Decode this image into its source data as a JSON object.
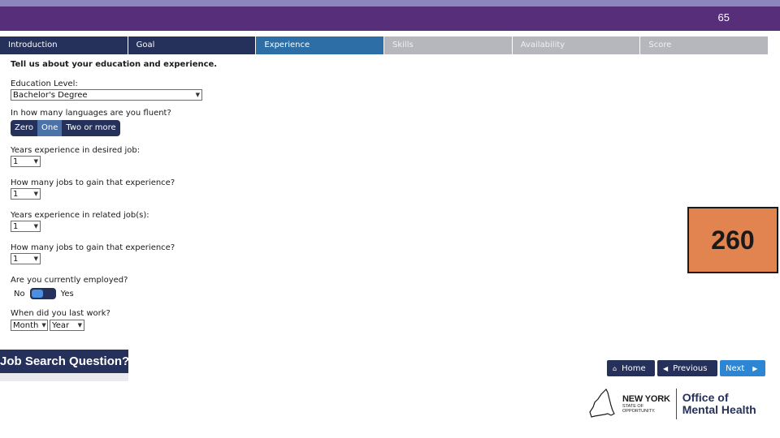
{
  "slide_number": "65",
  "tabs": [
    {
      "label": "Introduction",
      "state": "done"
    },
    {
      "label": "Goal",
      "state": "done"
    },
    {
      "label": "Experience",
      "state": "active"
    },
    {
      "label": "Skills",
      "state": "todo"
    },
    {
      "label": "Availability",
      "state": "todo"
    },
    {
      "label": "Score",
      "state": "todo"
    }
  ],
  "form": {
    "heading": "Tell us about your education and experience.",
    "education": {
      "label": "Education Level:",
      "value": "Bachelor's Degree"
    },
    "languages": {
      "label": "In how many languages are you fluent?",
      "options": [
        "Zero",
        "One",
        "Two or more"
      ],
      "selected": "One"
    },
    "years_desired": {
      "label": "Years experience in desired job:",
      "value": "1"
    },
    "jobs_desired": {
      "label": "How many jobs to gain that experience?",
      "value": "1"
    },
    "years_related": {
      "label": "Years experience in related job(s):",
      "value": "1"
    },
    "jobs_related": {
      "label": "How many jobs to gain that experience?",
      "value": "1"
    },
    "employed": {
      "label": "Are you currently employed?",
      "no_label": "No",
      "yes_label": "Yes",
      "value": "No"
    },
    "last_work": {
      "label": "When did you last work?",
      "month": "Month",
      "year": "Year"
    }
  },
  "badge": {
    "value": "260",
    "color": "#e2844f"
  },
  "job_search_title": "Job Search Question?",
  "nav": {
    "home": "Home",
    "previous": "Previous",
    "next": "Next"
  },
  "logo": {
    "state_line1": "NEW YORK",
    "state_line2": "STATE OF",
    "state_line3": "OPPORTUNITY.",
    "agency_line1": "Office of",
    "agency_line2": "Mental Health"
  },
  "colors": {
    "header_purple": "#572e7a",
    "navy": "#25315a",
    "active_blue": "#2d6ea6",
    "next_blue": "#2d86d4"
  }
}
